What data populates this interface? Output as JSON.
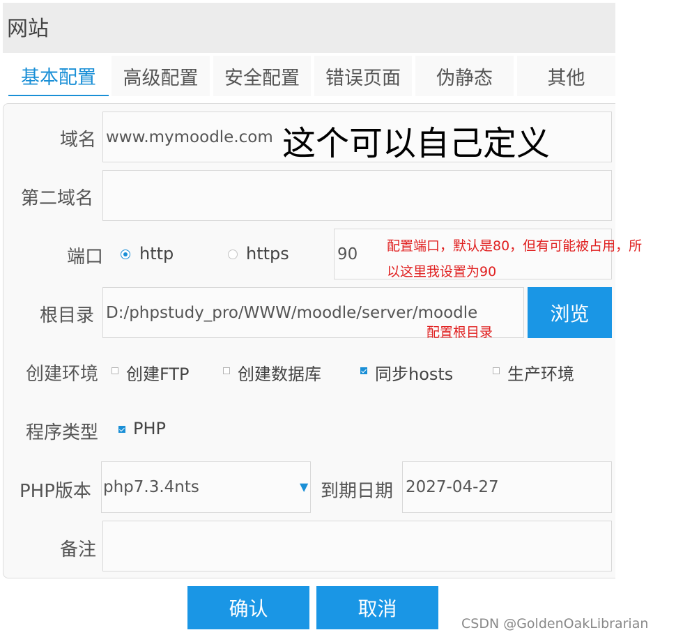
{
  "window": {
    "title": "网站"
  },
  "tabs": [
    {
      "label": "基本配置",
      "active": true
    },
    {
      "label": "高级配置"
    },
    {
      "label": "安全配置"
    },
    {
      "label": "错误页面"
    },
    {
      "label": "伪静态"
    },
    {
      "label": "其他"
    }
  ],
  "form": {
    "domain": {
      "label": "域名",
      "value": "www.mymoodle.com"
    },
    "second_domain": {
      "label": "第二域名",
      "value": ""
    },
    "port": {
      "label": "端口",
      "protocol_http": "http",
      "protocol_https": "https",
      "selected": "http",
      "value": "90"
    },
    "root_dir": {
      "label": "根目录",
      "value": "D:/phpstudy_pro/WWW/moodle/server/moodle",
      "browse_label": "浏览"
    },
    "environment": {
      "label": "创建环境",
      "options": [
        {
          "label": "创建FTP",
          "checked": false
        },
        {
          "label": "创建数据库",
          "checked": false
        },
        {
          "label": "同步hosts",
          "checked": true
        },
        {
          "label": "生产环境",
          "checked": false
        }
      ]
    },
    "program_type": {
      "label": "程序类型",
      "option": "PHP",
      "checked": true
    },
    "php_version": {
      "label": "PHP版本",
      "value": "php7.3.4nts"
    },
    "expire_date": {
      "label": "到期日期",
      "value": "2027-04-27"
    },
    "remark": {
      "label": "备注",
      "value": ""
    }
  },
  "buttons": {
    "confirm": "确认",
    "cancel": "取消"
  },
  "annotations": {
    "domain_note": "这个可以自己定义",
    "port_note_line1": "配置端口，默认是80，但有可能被占用，所",
    "port_note_line2": "以这里我设置为90",
    "root_note": "配置根目录"
  },
  "watermark": "CSDN @GoldenOakLibrarian",
  "colors": {
    "accent": "#1a96e5",
    "annotation_red": "#e02020"
  }
}
